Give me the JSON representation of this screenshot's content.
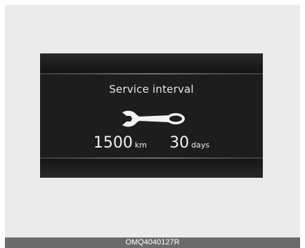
{
  "display": {
    "title": "Service interval",
    "icon": "wrench-icon",
    "distance_value": "1500",
    "distance_unit": "km",
    "days_value": "30",
    "days_unit": "days"
  },
  "caption": "OMQ4040127R"
}
